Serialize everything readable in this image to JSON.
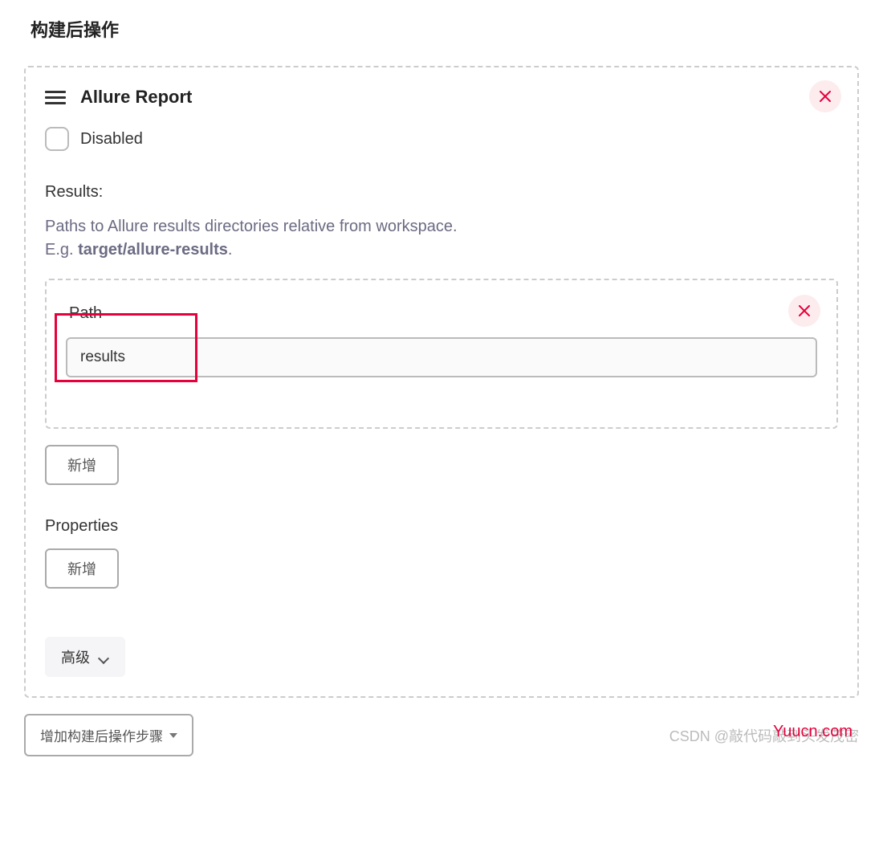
{
  "section": {
    "title": "构建后操作"
  },
  "panel": {
    "title": "Allure Report",
    "disabled_label": "Disabled",
    "results_label": "Results:",
    "description": "Paths to Allure results directories relative from workspace.",
    "eg_prefix": "E.g. ",
    "eg_bold": "target/allure-results",
    "eg_suffix": ".",
    "path_label": "Path",
    "path_value": "results",
    "add_button": "新增",
    "properties_label": "Properties",
    "advanced_button": "高级"
  },
  "footer": {
    "add_step_button": "增加构建后操作步骤",
    "watermark": "CSDN @敲代码敲到头发茂密",
    "top_watermark": "Yuucn.com"
  }
}
